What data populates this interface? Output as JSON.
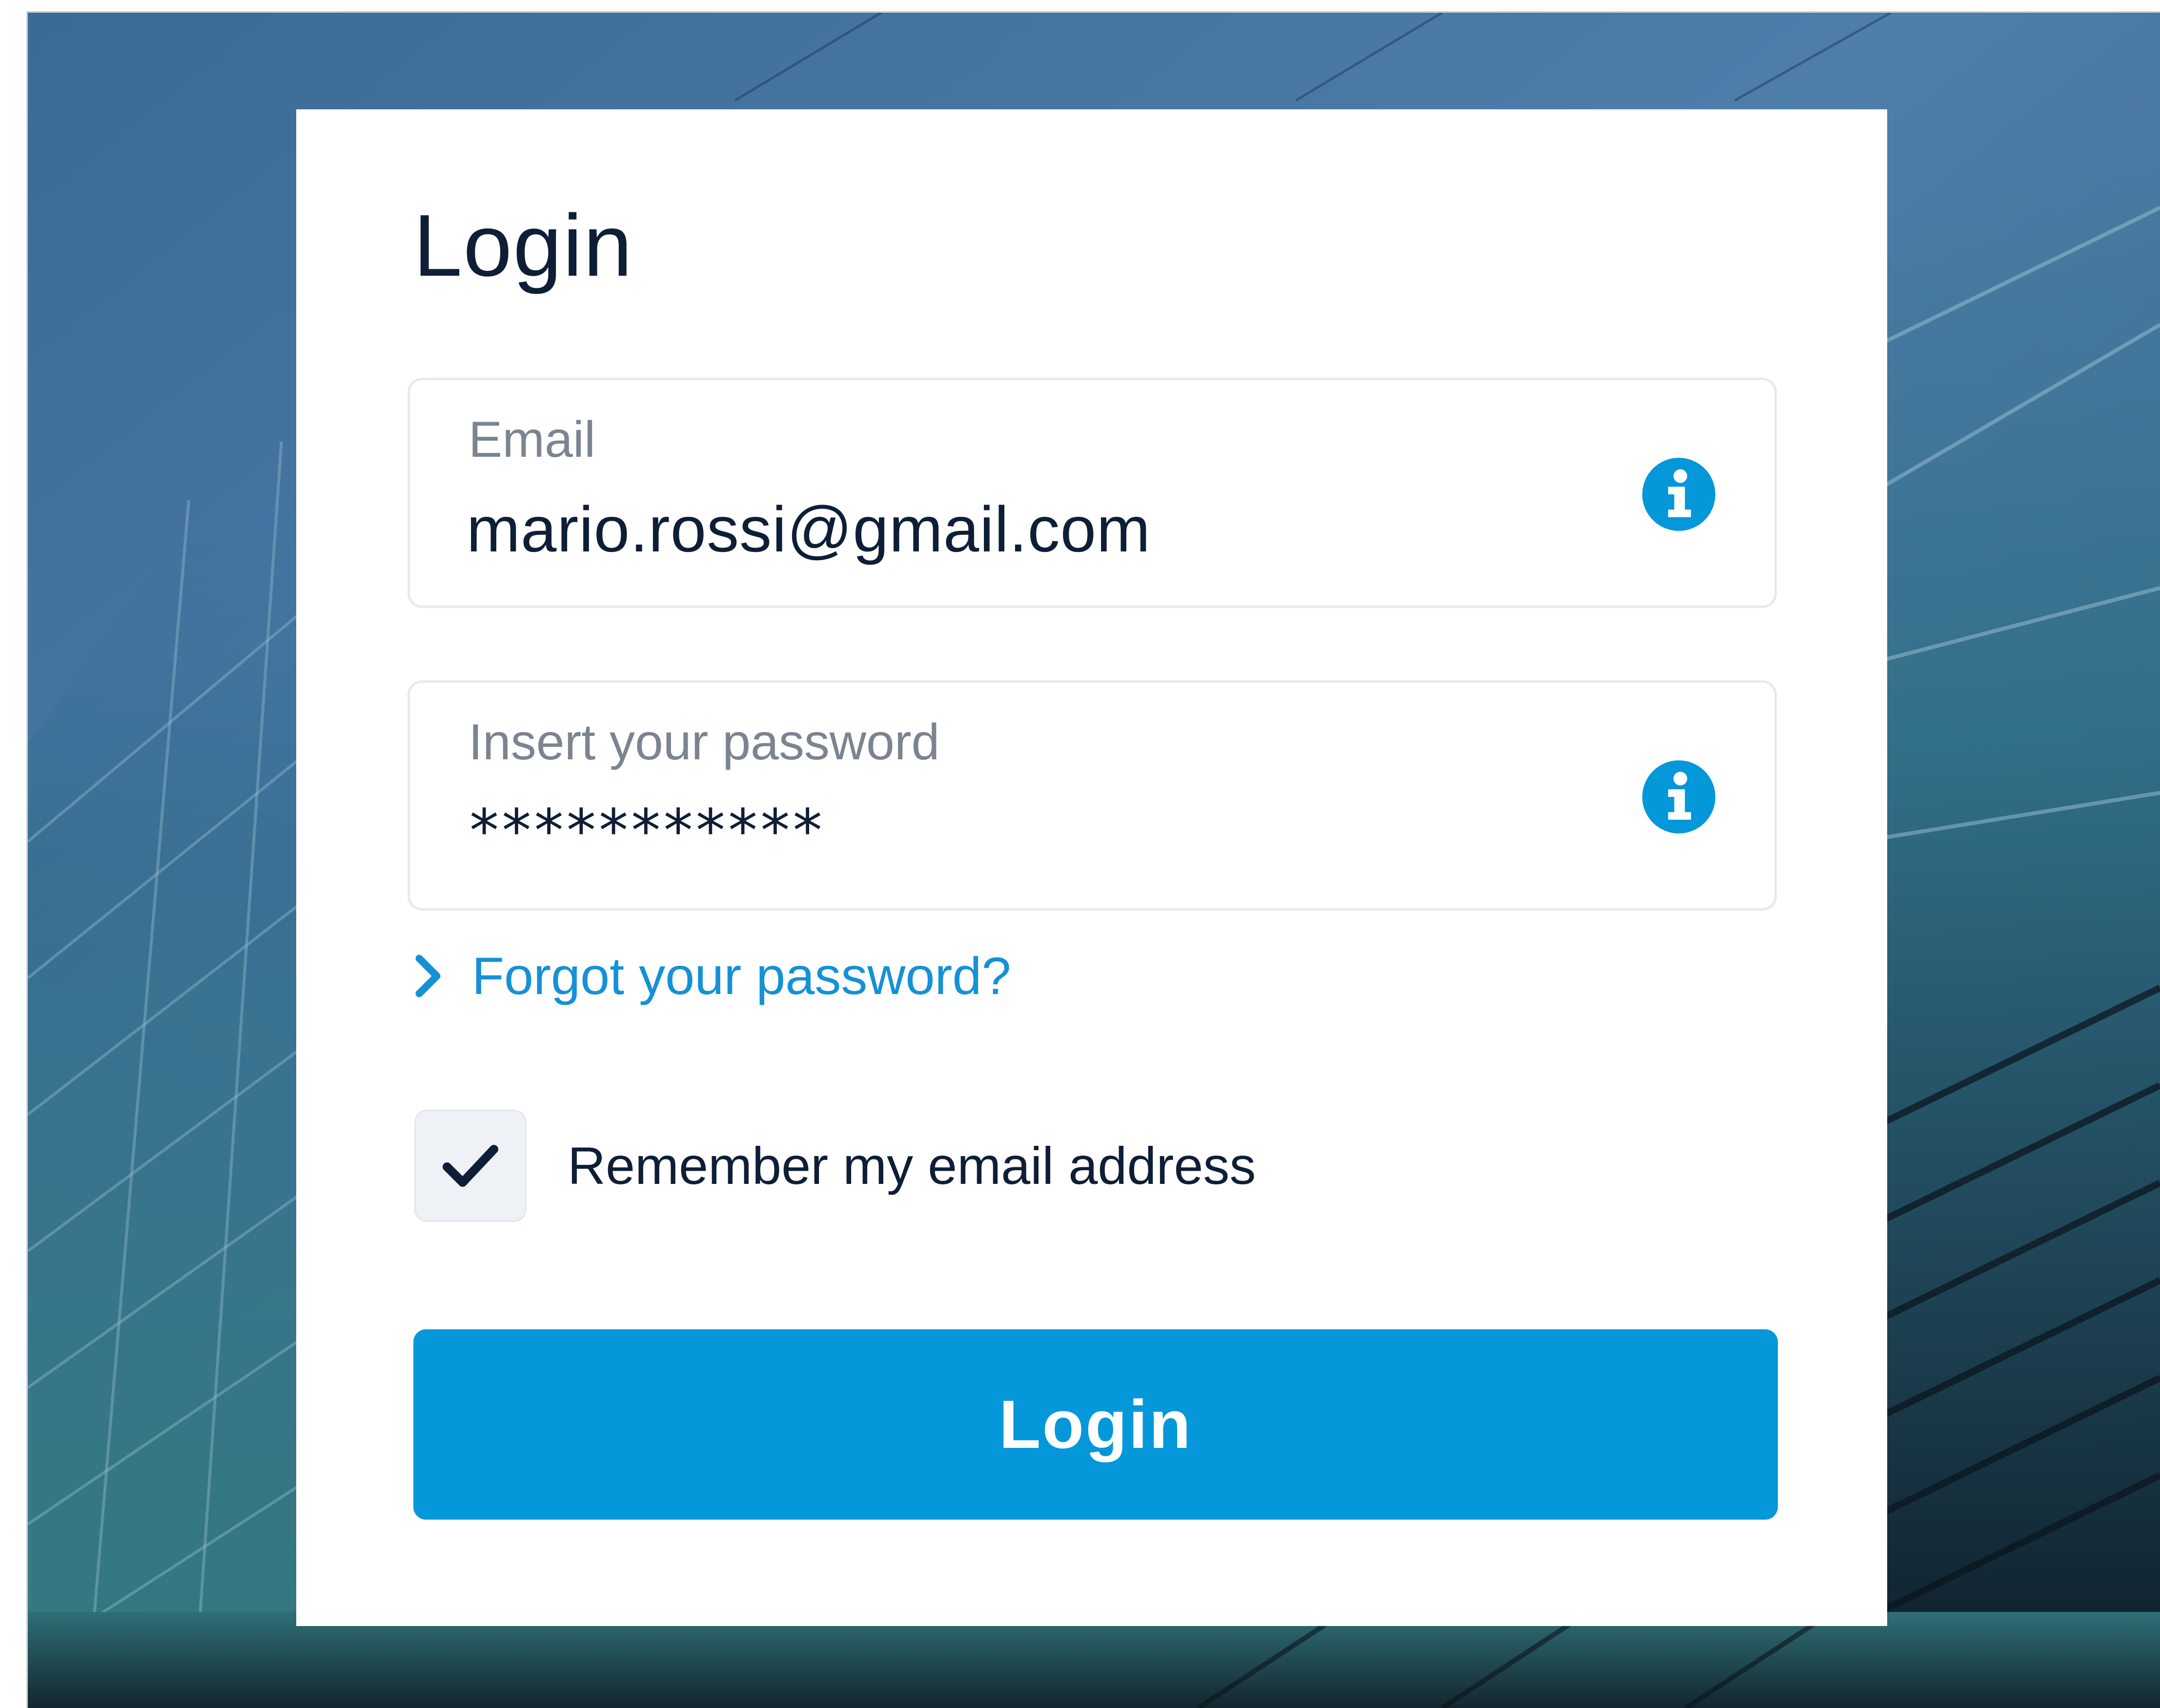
{
  "colors": {
    "accent": "#0497d9",
    "link": "#1591d6",
    "text_dark": "#0e1e36",
    "label_gray": "#7b8490",
    "field_border": "#e6e9ee",
    "checkbox_bg": "#eef1f5"
  },
  "login_card": {
    "title": "Login",
    "email": {
      "label": "Email",
      "value": "mario.rossi@gmail.com",
      "icon": "info-icon"
    },
    "password": {
      "label": "Insert your password",
      "value": "***********",
      "icon": "info-icon"
    },
    "forgot_password": {
      "label": "Forgot your password?",
      "icon": "chevron-right-icon"
    },
    "remember_email": {
      "label": "Remember my email address",
      "checked": true,
      "icon": "checkmark-icon"
    },
    "submit_label": "Login"
  },
  "background": {
    "description_icon": "glass-building-background"
  }
}
